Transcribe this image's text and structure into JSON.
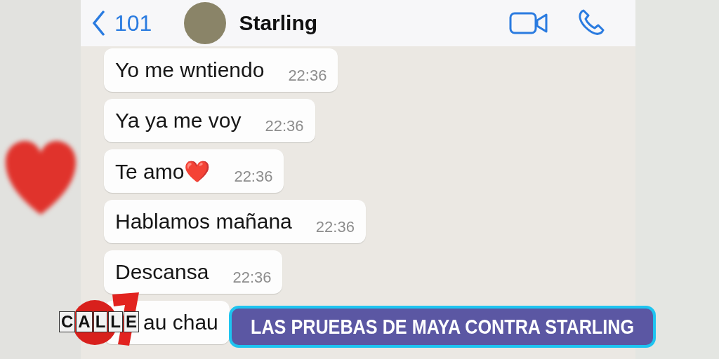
{
  "chat_header": {
    "back_label": "101",
    "contact_name": "Starling"
  },
  "messages": [
    {
      "text": "Yo me wntiendo",
      "time": "22:36"
    },
    {
      "text": "Ya ya me voy",
      "time": "22:36"
    },
    {
      "text": "Te amo❤️",
      "time": "22:36"
    },
    {
      "text": "Hablamos mañana",
      "time": "22:36"
    },
    {
      "text": "Descansa",
      "time": "22:36"
    },
    {
      "text": "au chau"
    }
  ],
  "broadcast": {
    "logo_text": "CALLE",
    "headline": "LAS PRUEBAS DE MAYA CONTRA STARLING"
  }
}
